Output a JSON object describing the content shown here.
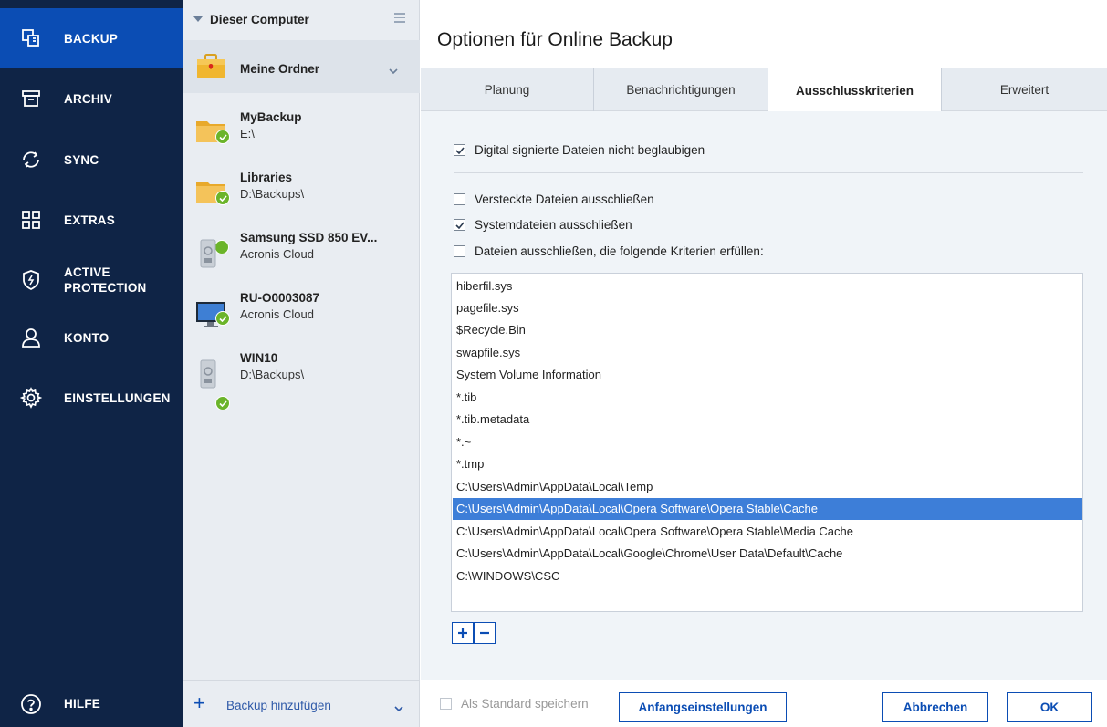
{
  "nav": {
    "items": [
      {
        "label": "BACKUP",
        "icon": "backup-icon"
      },
      {
        "label": "ARCHIV",
        "icon": "archive-icon"
      },
      {
        "label": "SYNC",
        "icon": "sync-icon"
      },
      {
        "label": "EXTRAS",
        "icon": "extras-grid-icon"
      },
      {
        "label_line1": "ACTIVE",
        "label_line2": "PROTECTION",
        "icon": "shield-icon"
      },
      {
        "label": "KONTO",
        "icon": "user-icon"
      },
      {
        "label": "EINSTELLUNGEN",
        "icon": "gear-icon"
      }
    ],
    "help": {
      "label": "HILFE",
      "icon": "help-icon"
    },
    "active_color": "#0b4db4",
    "bg_color": "#0f2446"
  },
  "middle": {
    "header_title": "Dieser Computer",
    "group_label": "Meine Ordner",
    "items": [
      {
        "name": "MyBackup",
        "sub": "E:\\",
        "icon": "folder-icon"
      },
      {
        "name": "Libraries",
        "sub": "D:\\Backups\\",
        "icon": "folder-icon"
      },
      {
        "name": "Samsung SSD 850 EV...",
        "sub": "Acronis Cloud",
        "icon": "drive-icon"
      },
      {
        "name": "RU-O0003087",
        "sub": "Acronis Cloud",
        "icon": "computer-icon"
      },
      {
        "name": "WIN10",
        "sub": "D:\\Backups\\",
        "icon": "drive-icon"
      }
    ],
    "footer_label": "Backup hinzufügen"
  },
  "main": {
    "title": "Optionen für Online Backup",
    "tabs": [
      "Planung",
      "Benachrichtigungen",
      "Ausschlusskriterien",
      "Erweitert"
    ],
    "active_tab": "Ausschlusskriterien",
    "options": [
      {
        "label": "Digital signierte Dateien nicht beglaubigen",
        "checked": true
      },
      {
        "label": "Versteckte Dateien ausschließen",
        "checked": false
      },
      {
        "label": "Systemdateien ausschließen",
        "checked": true
      },
      {
        "label": "Dateien ausschließen, die folgende Kriterien erfüllen:",
        "checked": false
      }
    ],
    "exclusions": [
      "hiberfil.sys",
      "pagefile.sys",
      "$Recycle.Bin",
      "swapfile.sys",
      "System Volume Information",
      "*.tib",
      "*.tib.metadata",
      "*.~",
      "*.tmp",
      "C:\\Users\\Admin\\AppData\\Local\\Temp",
      "C:\\Users\\Admin\\AppData\\Local\\Opera Software\\Opera Stable\\Cache",
      "C:\\Users\\Admin\\AppData\\Local\\Opera Software\\Opera Stable\\Media Cache",
      "C:\\Users\\Admin\\AppData\\Local\\Google\\Chrome\\User Data\\Default\\Cache",
      "C:\\WINDOWS\\CSC"
    ],
    "selected_exclusion": "C:\\Users\\Admin\\AppData\\Local\\Opera Software\\Opera Stable\\Cache",
    "add_button": "+",
    "remove_button": "−"
  },
  "footer": {
    "save_default": "Als Standard speichern",
    "reset_button": "Anfangseinstellungen",
    "cancel_button": "Abbrechen",
    "ok_button": "OK"
  }
}
